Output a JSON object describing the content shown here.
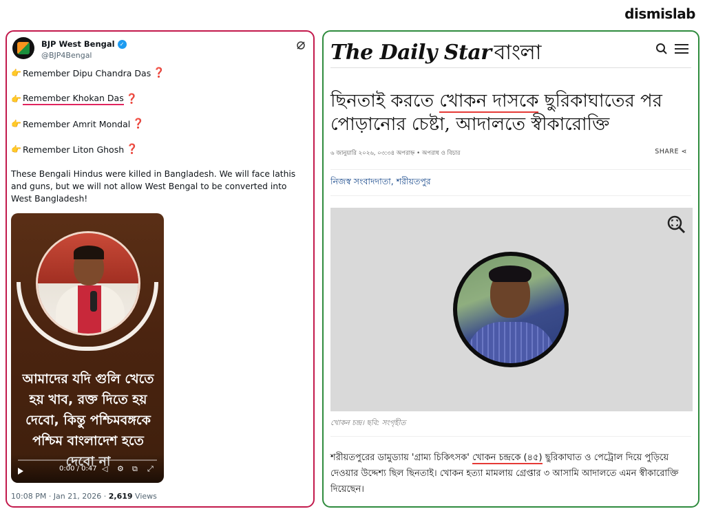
{
  "brand": "dismislab",
  "tweet": {
    "name": "BJP West Bengal",
    "handle": "@BJP4Bengal",
    "lines": [
      {
        "prefix": "Remember ",
        "name": "Dipu Chandra Das"
      },
      {
        "prefix": "Remember ",
        "name": "Khokan Das"
      },
      {
        "prefix": "Remember ",
        "name": "Amrit Mondal"
      },
      {
        "prefix": "Remember ",
        "name": "Liton Ghosh"
      }
    ],
    "hand_emoji": "👉",
    "question_mark": "❓",
    "body": "These Bengali Hindus were killed in Bangladesh. We will face lathis and guns, but we will not allow West Bengal to be converted into West Bangladesh!",
    "video": {
      "caption": "আমাদের যদি গুলি খেতে হয় খাব, রক্ত দিতে হয় দেবো, কিন্তু পশ্চিমবঙ্গকে পশ্চিম বাংলাদেশ হতে দেবো না",
      "time": "0:00 / 0:47",
      "progress": 0.0
    },
    "timestamp": "10:08 PM · Jan 21, 2026 · ",
    "views_count": "2,619",
    "views_label": " Views"
  },
  "article": {
    "logo_en": "The Daily Star",
    "logo_bn": "বাংলা",
    "headline_pre": "ছিনতাই করতে ",
    "headline_ul": "খোকন দাসকে",
    "headline_post": " ছুরিকাঘাতের পর পোড়ানোর চেষ্টা, আদালতে স্বীকারোক্তি",
    "dateline": "৬ জানুয়ারি ২০২৬, ০৩:৩৪ অপরাহ্ন • অপরাধ ও বিচার",
    "share": "SHARE",
    "byline": "নিজস্ব সংবাদদাতা, শরীয়তপুর",
    "caption": "খোকন চন্দ্র। ছবি: সংগৃহীত",
    "lead_pre": "শরীয়তপুরের ডামুড্যায় 'গ্রাম্য চিকিৎসক' ",
    "lead_ul": "খোকন চন্দ্রকে (৪৫)",
    "lead_post": " ছুরিকাঘাত ও পেট্রোল দিয়ে পুড়িয়ে দেওয়ার উদ্দেশ্য ছিল ছিনতাই। খোকন হত্যা মামলায় গ্রেপ্তার ৩ আসামি আদালতে এমন স্বীকারোক্তি দিয়েছেন।"
  },
  "colors": {
    "left_border": "#c2184b",
    "right_border": "#2e8b3d",
    "highlight": "#e53935"
  }
}
